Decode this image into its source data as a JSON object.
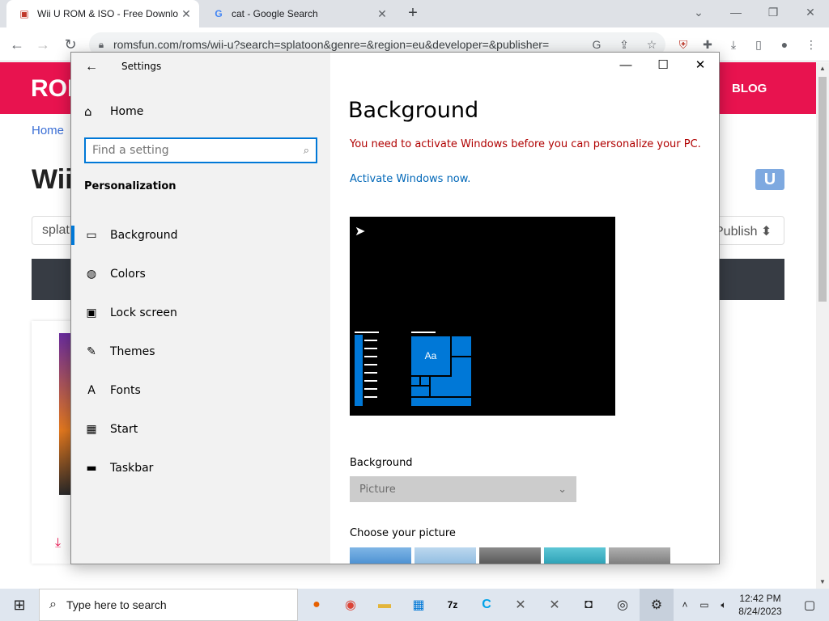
{
  "browser": {
    "tabs": [
      {
        "title": "Wii U ROM & ISO - Free Download",
        "favicon": "romsfun-favicon",
        "active": true
      },
      {
        "title": "cat - Google Search",
        "favicon": "google-favicon",
        "active": false
      }
    ],
    "new_tab": "+",
    "url": "romsfun.com/roms/wii-u?search=splatoon&genre=&region=eu&developer=&publisher=",
    "window_controls": {
      "minimize": "—",
      "restore": "❐",
      "close": "✕"
    }
  },
  "site": {
    "logo": "ROI",
    "nav_blog": "BLOG",
    "breadcrumb": "Home",
    "heading": "Wii",
    "badge": "U",
    "search_value": "splat",
    "publisher_select": "Publish",
    "download_icon": "⤓"
  },
  "settings": {
    "window_title": "Settings",
    "back": "←",
    "home_label": "Home",
    "search_placeholder": "Find a setting",
    "section_title": "Personalization",
    "nav_items": [
      {
        "label": "Background",
        "icon": "picture-icon",
        "glyph": "▭",
        "selected": true
      },
      {
        "label": "Colors",
        "icon": "palette-icon",
        "glyph": "◍",
        "selected": false
      },
      {
        "label": "Lock screen",
        "icon": "lock-screen-icon",
        "glyph": "▣",
        "selected": false
      },
      {
        "label": "Themes",
        "icon": "themes-icon",
        "glyph": "✎",
        "selected": false
      },
      {
        "label": "Fonts",
        "icon": "fonts-icon",
        "glyph": "A",
        "selected": false
      },
      {
        "label": "Start",
        "icon": "start-icon",
        "glyph": "▦",
        "selected": false
      },
      {
        "label": "Taskbar",
        "icon": "taskbar-icon",
        "glyph": "▬",
        "selected": false
      }
    ],
    "controls": {
      "minimize": "—",
      "maximize": "☐",
      "close": "✕"
    },
    "content": {
      "title": "Background",
      "warning": "You need to activate Windows before you can personalize your PC.",
      "activate_link": "Activate Windows now.",
      "preview_tile_text": "Aa",
      "background_label": "Background",
      "background_value": "Picture",
      "choose_label": "Choose your picture"
    }
  },
  "taskbar": {
    "search_placeholder": "Type here to search",
    "time": "12:42 PM",
    "date": "8/24/2023",
    "accent": "#0078d7"
  }
}
